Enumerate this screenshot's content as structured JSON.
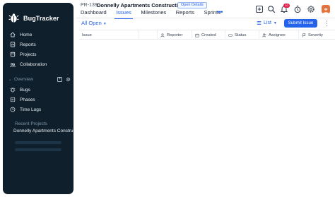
{
  "app": {
    "name": "BugTracker"
  },
  "sidebar": {
    "nav": [
      {
        "label": "Home",
        "icon": "home-icon"
      },
      {
        "label": "Reports",
        "icon": "reports-icon"
      },
      {
        "label": "Projects",
        "icon": "projects-icon"
      },
      {
        "label": "Collaboration",
        "icon": "collaboration-icon"
      }
    ],
    "overview": {
      "label": "Overview"
    },
    "sub_nav": [
      {
        "label": "Bugs",
        "icon": "bug-icon"
      },
      {
        "label": "Phases",
        "icon": "phases-icon"
      },
      {
        "label": "Time Logs",
        "icon": "clock-icon"
      }
    ],
    "recent_label": "Recent Projects",
    "recent_item": "Donnelly Apartments Construction"
  },
  "header": {
    "project_id": "PR-139",
    "project_name": "Donnelly Apartments Construction",
    "open_details": "Open Details",
    "tabs": [
      "Dashboard",
      "Issues",
      "Milestones",
      "Reports",
      "Sprints"
    ],
    "active_tab": "Issues",
    "more": "•••",
    "notification_count": "10"
  },
  "toolbar": {
    "view": "All Open",
    "layout": "List",
    "submit_label": "Submit Issue"
  },
  "table": {
    "columns": [
      "Issue",
      "Reporter",
      "Created",
      "Status",
      "Assignee",
      "Severity"
    ]
  },
  "colors": {
    "sidebar_bg": "#0f1f2c",
    "accent": "#2563eb",
    "badge": "#e11d48"
  }
}
